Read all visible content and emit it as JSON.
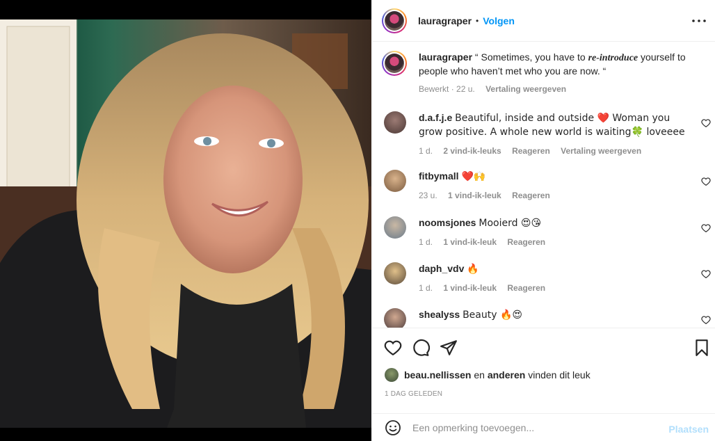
{
  "post": {
    "username": "lauragraper",
    "follow_label": "Volgen",
    "separator": "•",
    "more_icon": "more-horizontal-icon"
  },
  "caption": {
    "username": "lauragraper",
    "text_before": " “ Sometimes, you have to ",
    "text_emph": "re-introduce",
    "text_after": " yourself to people who haven’t met who you are now. “",
    "edited": "Bewerkt",
    "age": "22 u.",
    "translate": "Vertaling weergeven"
  },
  "comments": [
    {
      "username": "d.a.f.j.e",
      "text": "Beautiful, inside and outside ❤️ Woman you grow positive. A whole new world is waiting🍀 loveeee",
      "age": "1 d.",
      "likes": "2 vind-ik-leuks",
      "reply": "Reageren",
      "translate": "Vertaling weergeven"
    },
    {
      "username": "fitbymall",
      "text": "❤️🙌",
      "age": "23 u.",
      "likes": "1 vind-ik-leuk",
      "reply": "Reageren"
    },
    {
      "username": "noomsjones",
      "text": "Mooierd 😍😘",
      "age": "1 d.",
      "likes": "1 vind-ik-leuk",
      "reply": "Reageren"
    },
    {
      "username": "daph_vdv",
      "text": "🔥",
      "age": "1 d.",
      "likes": "1 vind-ik-leuk",
      "reply": "Reageren"
    },
    {
      "username": "shealyss",
      "text": "Beauty 🔥😍"
    }
  ],
  "likes_line": {
    "user": "beau.nellissen",
    "connector": " en ",
    "others": "anderen",
    "suffix": " vinden dit leuk"
  },
  "timestamp": "1 DAG GELEDEN",
  "composer": {
    "placeholder": "Een opmerking toevoegen...",
    "post_label": "Plaatsen"
  },
  "colors": {
    "accent": "#0095f6",
    "muted": "#8e8e8e",
    "post_disabled": "#b2dffc",
    "heart": "#ed4956"
  }
}
